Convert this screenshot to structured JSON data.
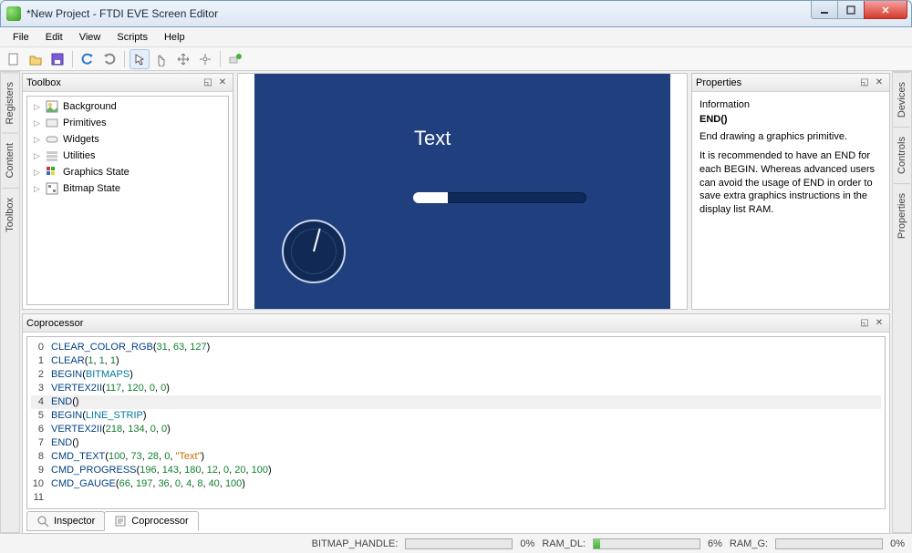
{
  "window": {
    "title": "*New Project - FTDI EVE Screen Editor"
  },
  "menu": {
    "file": "File",
    "edit": "Edit",
    "view": "View",
    "scripts": "Scripts",
    "help": "Help"
  },
  "leftTabs": {
    "registers": "Registers",
    "content": "Content",
    "toolbox": "Toolbox"
  },
  "rightTabs": {
    "devices": "Devices",
    "controls": "Controls",
    "properties": "Properties"
  },
  "toolbox": {
    "title": "Toolbox",
    "items": [
      {
        "label": "Background"
      },
      {
        "label": "Primitives"
      },
      {
        "label": "Widgets"
      },
      {
        "label": "Utilities"
      },
      {
        "label": "Graphics State"
      },
      {
        "label": "Bitmap State"
      }
    ]
  },
  "canvas": {
    "text": "Text"
  },
  "properties": {
    "title": "Properties",
    "section": "Information",
    "func": "END()",
    "p1": "End drawing a graphics primitive.",
    "p2": "It is recommended to have an END for each BEGIN. Whereas advanced users can avoid the usage of END in order to save extra graphics instructions in the display list RAM."
  },
  "coprocessor": {
    "title": "Coprocessor"
  },
  "code": [
    {
      "n": "0",
      "fn": "CLEAR_COLOR_RGB",
      "args": [
        [
          "num",
          "31"
        ],
        [
          "plain",
          ", "
        ],
        [
          "num",
          "63"
        ],
        [
          "plain",
          ", "
        ],
        [
          "num",
          "127"
        ]
      ]
    },
    {
      "n": "1",
      "fn": "CLEAR",
      "args": [
        [
          "num",
          "1"
        ],
        [
          "plain",
          ", "
        ],
        [
          "num",
          "1"
        ],
        [
          "plain",
          ", "
        ],
        [
          "num",
          "1"
        ]
      ]
    },
    {
      "n": "2",
      "fn": "BEGIN",
      "args": [
        [
          "const",
          "BITMAPS"
        ]
      ]
    },
    {
      "n": "3",
      "fn": "VERTEX2II",
      "args": [
        [
          "num",
          "117"
        ],
        [
          "plain",
          ", "
        ],
        [
          "num",
          "120"
        ],
        [
          "plain",
          ", "
        ],
        [
          "num",
          "0"
        ],
        [
          "plain",
          ", "
        ],
        [
          "num",
          "0"
        ]
      ]
    },
    {
      "n": "4",
      "fn": "END",
      "args": [],
      "sel": true
    },
    {
      "n": "5",
      "fn": "BEGIN",
      "args": [
        [
          "const",
          "LINE_STRIP"
        ]
      ]
    },
    {
      "n": "6",
      "fn": "VERTEX2II",
      "args": [
        [
          "num",
          "218"
        ],
        [
          "plain",
          ", "
        ],
        [
          "num",
          "134"
        ],
        [
          "plain",
          ", "
        ],
        [
          "num",
          "0"
        ],
        [
          "plain",
          ", "
        ],
        [
          "num",
          "0"
        ]
      ]
    },
    {
      "n": "7",
      "fn": "END",
      "args": []
    },
    {
      "n": "8",
      "fn": "CMD_TEXT",
      "args": [
        [
          "num",
          "100"
        ],
        [
          "plain",
          ", "
        ],
        [
          "num",
          "73"
        ],
        [
          "plain",
          ", "
        ],
        [
          "num",
          "28"
        ],
        [
          "plain",
          ", "
        ],
        [
          "num",
          "0"
        ],
        [
          "plain",
          ", "
        ],
        [
          "str",
          "\"Text\""
        ]
      ]
    },
    {
      "n": "9",
      "fn": "CMD_PROGRESS",
      "args": [
        [
          "num",
          "196"
        ],
        [
          "plain",
          ", "
        ],
        [
          "num",
          "143"
        ],
        [
          "plain",
          ", "
        ],
        [
          "num",
          "180"
        ],
        [
          "plain",
          ", "
        ],
        [
          "num",
          "12"
        ],
        [
          "plain",
          ", "
        ],
        [
          "num",
          "0"
        ],
        [
          "plain",
          ", "
        ],
        [
          "num",
          "20"
        ],
        [
          "plain",
          ", "
        ],
        [
          "num",
          "100"
        ]
      ]
    },
    {
      "n": "10",
      "fn": "CMD_GAUGE",
      "args": [
        [
          "num",
          "66"
        ],
        [
          "plain",
          ", "
        ],
        [
          "num",
          "197"
        ],
        [
          "plain",
          ", "
        ],
        [
          "num",
          "36"
        ],
        [
          "plain",
          ", "
        ],
        [
          "num",
          "0"
        ],
        [
          "plain",
          ", "
        ],
        [
          "num",
          "4"
        ],
        [
          "plain",
          ", "
        ],
        [
          "num",
          "8"
        ],
        [
          "plain",
          ", "
        ],
        [
          "num",
          "40"
        ],
        [
          "plain",
          ", "
        ],
        [
          "num",
          "100"
        ]
      ]
    },
    {
      "n": "11",
      "fn": "",
      "args": []
    }
  ],
  "tabs": {
    "inspector": "Inspector",
    "coprocessor": "Coprocessor"
  },
  "status": {
    "bitmap_label": "BITMAP_HANDLE:",
    "bitmap_pct": "0%",
    "ramdl_label": "RAM_DL:",
    "ramdl_pct": "6%",
    "ramg_label": "RAM_G:",
    "ramg_pct": "0%"
  }
}
